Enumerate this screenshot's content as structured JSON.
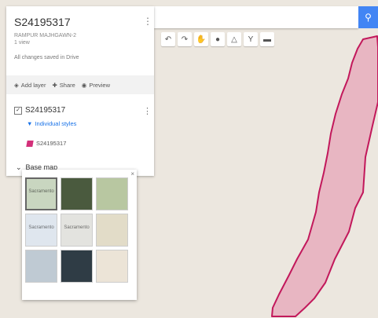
{
  "map_title": "S24195317",
  "map_subtitle": "RAMPUR MAJHGAWN-2",
  "views": "1 view",
  "saved_status": "All changes saved in Drive",
  "actions": {
    "add_layer": "Add layer",
    "share": "Share",
    "preview": "Preview"
  },
  "layer": {
    "name": "S24195317",
    "style_link": "Individual styles",
    "item_name": "S24195317"
  },
  "base_map_label": "Base map",
  "base_map_thumbs": [
    {
      "label": "Sacramento",
      "color": "#c9d6c0"
    },
    {
      "label": "",
      "color": "#4a5a3e"
    },
    {
      "label": "",
      "color": "#b8c7a1"
    },
    {
      "label": "Sacramento",
      "color": "#dfe6ee"
    },
    {
      "label": "Sacramento",
      "color": "#e3e3df"
    },
    {
      "label": "",
      "color": "#e2dcc8"
    },
    {
      "label": "",
      "color": "#bfcad3"
    },
    {
      "label": "",
      "color": "#2f3c45"
    },
    {
      "label": "",
      "color": "#ece4d7"
    }
  ],
  "polygon": {
    "fill": "#e8b6c2",
    "stroke": "#c2185b"
  },
  "search_button_color": "#4285f4"
}
